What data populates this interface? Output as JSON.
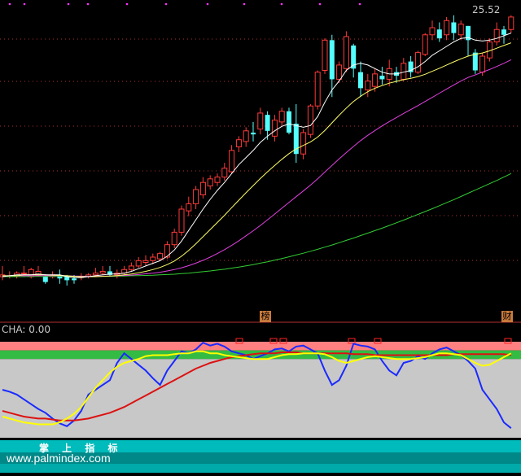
{
  "price_panel": {
    "last_price_label": "25.52",
    "badges": [
      "榜",
      "财"
    ]
  },
  "indicator_panel": {
    "cha_label": "CHA: 0.00"
  },
  "footer": {
    "title": "掌 上 指 标",
    "url": "www.palmindex.com"
  },
  "colors": {
    "background": "#000000",
    "candle_up": "#ff3a3a",
    "candle_down": "#54ffff",
    "ma_white": "#ffffff",
    "ma_yellow": "#ffff66",
    "ma_magenta": "#e040e0",
    "ma_green": "#33cc33",
    "band_red": "#ff8080",
    "band_green": "#33bb44",
    "band_gray": "#c8c8c8",
    "line_blue": "#1a2aff",
    "line_red": "#dd1111",
    "line_yellow": "#ffff00",
    "footer_teal": "#00bbbb"
  },
  "chart_data": [
    {
      "type": "candlestick",
      "title": "",
      "ylabel": "",
      "last_price": 25.52,
      "ylim": [
        9.3,
        26.0
      ],
      "candles": [
        [
          10.9,
          11.0,
          11.5,
          10.7
        ],
        [
          10.9,
          10.95,
          11.2,
          10.8
        ],
        [
          10.9,
          11.1,
          11.2,
          10.8
        ],
        [
          11.1,
          11.1,
          11.5,
          10.9
        ],
        [
          10.9,
          11.3,
          11.4,
          10.8
        ],
        [
          11.0,
          11.2,
          11.5,
          10.9
        ],
        [
          10.9,
          10.6,
          11.0,
          10.5
        ],
        [
          10.9,
          11.0,
          11.2,
          10.8
        ],
        [
          11.0,
          10.8,
          11.3,
          10.5
        ],
        [
          10.9,
          10.7,
          11.0,
          10.4
        ],
        [
          10.8,
          10.7,
          11.0,
          10.5
        ],
        [
          10.9,
          10.9,
          11.1,
          10.7
        ],
        [
          10.9,
          11.0,
          11.1,
          10.8
        ],
        [
          11.0,
          11.1,
          11.4,
          10.9
        ],
        [
          11.1,
          11.2,
          11.5,
          11.0
        ],
        [
          11.2,
          11.0,
          11.5,
          10.9
        ],
        [
          11.0,
          11.1,
          11.3,
          10.8
        ],
        [
          11.1,
          11.3,
          11.5,
          11.0
        ],
        [
          11.3,
          11.5,
          11.7,
          11.2
        ],
        [
          11.5,
          11.8,
          12.0,
          11.4
        ],
        [
          11.7,
          11.8,
          12.1,
          11.5
        ],
        [
          11.8,
          12.0,
          12.2,
          11.6
        ],
        [
          11.9,
          12.2,
          12.3,
          11.8
        ],
        [
          12.0,
          12.7,
          12.9,
          11.9
        ],
        [
          12.7,
          13.4,
          13.6,
          12.5
        ],
        [
          13.4,
          14.7,
          14.9,
          13.2
        ],
        [
          14.6,
          15.0,
          15.4,
          14.3
        ],
        [
          15.0,
          15.8,
          16.0,
          14.7
        ],
        [
          15.5,
          16.2,
          16.5,
          15.3
        ],
        [
          16.0,
          16.4,
          16.6,
          15.8
        ],
        [
          16.2,
          16.5,
          16.7,
          16.0
        ],
        [
          16.5,
          17.0,
          17.3,
          16.3
        ],
        [
          16.8,
          18.0,
          18.3,
          16.7
        ],
        [
          18.2,
          18.6,
          18.8,
          17.9
        ],
        [
          18.5,
          19.1,
          19.3,
          18.2
        ],
        [
          19.0,
          18.9,
          19.6,
          18.5
        ],
        [
          19.2,
          20.1,
          20.4,
          18.9
        ],
        [
          20.0,
          19.1,
          20.2,
          18.6
        ],
        [
          18.8,
          19.7,
          20.0,
          18.5
        ],
        [
          19.6,
          20.2,
          20.4,
          19.4
        ],
        [
          20.2,
          19.0,
          20.4,
          18.9
        ],
        [
          19.5,
          17.8,
          20.6,
          17.3
        ],
        [
          17.8,
          19.0,
          19.2,
          17.5
        ],
        [
          18.9,
          20.5,
          20.6,
          18.7
        ],
        [
          20.5,
          22.4,
          22.5,
          20.3
        ],
        [
          22.5,
          24.2,
          24.3,
          22.3
        ],
        [
          24.2,
          22.0,
          24.5,
          21.0
        ],
        [
          22.0,
          22.8,
          23.0,
          21.8
        ],
        [
          22.6,
          24.4,
          24.7,
          22.4
        ],
        [
          23.9,
          22.6,
          24.0,
          22.1
        ],
        [
          22.4,
          21.5,
          23.0,
          21.0
        ],
        [
          21.4,
          21.9,
          22.3,
          21.0
        ],
        [
          21.6,
          22.3,
          22.6,
          21.3
        ],
        [
          22.2,
          22.0,
          22.7,
          21.7
        ],
        [
          22.0,
          22.6,
          23.1,
          21.6
        ],
        [
          22.4,
          22.2,
          22.7,
          21.8
        ],
        [
          22.0,
          22.9,
          23.2,
          21.9
        ],
        [
          23.0,
          22.4,
          23.3,
          22.1
        ],
        [
          22.4,
          23.5,
          23.6,
          22.3
        ],
        [
          23.4,
          24.5,
          24.6,
          23.3
        ],
        [
          24.5,
          24.9,
          25.3,
          24.2
        ],
        [
          24.8,
          24.3,
          25.2,
          24.1
        ],
        [
          24.5,
          25.3,
          25.5,
          24.2
        ],
        [
          25.2,
          24.6,
          25.6,
          24.2
        ],
        [
          24.5,
          25.1,
          25.3,
          24.2
        ],
        [
          25.0,
          24.2,
          25.0,
          23.3
        ],
        [
          23.5,
          22.5,
          23.7,
          22.3
        ],
        [
          22.4,
          23.3,
          23.5,
          22.2
        ],
        [
          23.2,
          24.1,
          24.3,
          23.0
        ],
        [
          24.1,
          24.8,
          25.2,
          23.9
        ],
        [
          24.8,
          24.5,
          25.0,
          24.0
        ],
        [
          24.8,
          25.5,
          25.6,
          24.6
        ]
      ],
      "ma_white": [
        10.9,
        10.95,
        11.0,
        11.0,
        11.0,
        11.05,
        11.0,
        11.0,
        11.0,
        10.9,
        10.85,
        10.85,
        10.9,
        10.95,
        11.0,
        11.05,
        11.05,
        11.1,
        11.2,
        11.35,
        11.5,
        11.65,
        11.8,
        12.05,
        12.4,
        12.9,
        13.5,
        14.1,
        14.7,
        15.25,
        15.75,
        16.2,
        16.7,
        17.2,
        17.6,
        18.0,
        18.45,
        18.8,
        19.1,
        19.35,
        19.5,
        19.4,
        19.3,
        19.4,
        19.9,
        20.7,
        21.4,
        21.9,
        22.5,
        22.8,
        22.9,
        22.8,
        22.6,
        22.4,
        22.3,
        22.3,
        22.4,
        22.5,
        22.7,
        23.0,
        23.35,
        23.6,
        23.85,
        24.1,
        24.3,
        24.35,
        24.2,
        24.15,
        24.2,
        24.3,
        24.45,
        24.6
      ],
      "ma_yellow": [
        10.95,
        10.95,
        10.95,
        11.0,
        11.0,
        11.0,
        11.0,
        10.98,
        10.97,
        10.95,
        10.92,
        10.9,
        10.9,
        10.9,
        10.92,
        10.94,
        10.96,
        11.0,
        11.05,
        11.12,
        11.2,
        11.3,
        11.42,
        11.58,
        11.78,
        12.05,
        12.38,
        12.75,
        13.15,
        13.55,
        13.95,
        14.35,
        14.78,
        15.2,
        15.62,
        16.02,
        16.42,
        16.8,
        17.15,
        17.5,
        17.82,
        18.08,
        18.28,
        18.48,
        18.75,
        19.12,
        19.55,
        19.98,
        20.38,
        20.75,
        21.05,
        21.3,
        21.5,
        21.65,
        21.78,
        21.88,
        21.98,
        22.05,
        22.15,
        22.28,
        22.45,
        22.62,
        22.8,
        22.98,
        23.15,
        23.3,
        23.4,
        23.48,
        23.6,
        23.75,
        23.9,
        24.05
      ],
      "ma_magenta": [
        10.95,
        10.95,
        10.95,
        10.95,
        10.95,
        10.96,
        10.96,
        10.96,
        10.96,
        10.95,
        10.94,
        10.93,
        10.92,
        10.92,
        10.93,
        10.94,
        10.95,
        10.97,
        10.99,
        11.02,
        11.06,
        11.1,
        11.15,
        11.22,
        11.3,
        11.4,
        11.52,
        11.66,
        11.82,
        12.0,
        12.2,
        12.42,
        12.66,
        12.92,
        13.2,
        13.48,
        13.78,
        14.1,
        14.42,
        14.75,
        15.08,
        15.4,
        15.72,
        16.05,
        16.4,
        16.78,
        17.15,
        17.52,
        17.88,
        18.22,
        18.55,
        18.85,
        19.12,
        19.38,
        19.62,
        19.85,
        20.08,
        20.3,
        20.52,
        20.75,
        20.98,
        21.22,
        21.45,
        21.68,
        21.9,
        22.1,
        22.25,
        22.4,
        22.55,
        22.72,
        22.9,
        23.1
      ],
      "ma_green": [
        10.9,
        10.9,
        10.9,
        10.9,
        10.91,
        10.91,
        10.91,
        10.91,
        10.91,
        10.91,
        10.91,
        10.91,
        10.91,
        10.91,
        10.92,
        10.92,
        10.93,
        10.94,
        10.95,
        10.96,
        10.97,
        10.98,
        11.0,
        11.02,
        11.04,
        11.07,
        11.1,
        11.14,
        11.18,
        11.22,
        11.27,
        11.32,
        11.38,
        11.44,
        11.51,
        11.58,
        11.66,
        11.74,
        11.83,
        11.92,
        12.02,
        12.12,
        12.22,
        12.33,
        12.44,
        12.56,
        12.68,
        12.81,
        12.94,
        13.07,
        13.21,
        13.35,
        13.49,
        13.63,
        13.78,
        13.93,
        14.08,
        14.24,
        14.4,
        14.56,
        14.72,
        14.89,
        15.06,
        15.23,
        15.41,
        15.59,
        15.77,
        15.95,
        16.13,
        16.31,
        16.5,
        16.7
      ]
    },
    {
      "type": "line",
      "title": "CHA: 0.00",
      "ylim": [
        0,
        100
      ],
      "bands": [
        {
          "color": "band_red",
          "from": 91,
          "to": 100
        },
        {
          "color": "band_green",
          "from": 82,
          "to": 91
        },
        {
          "color": "band_gray",
          "from": 0,
          "to": 82
        }
      ],
      "series": [
        {
          "color": "line_blue",
          "values": [
            50,
            48,
            45,
            40,
            35,
            30,
            26,
            20,
            15,
            12,
            18,
            28,
            45,
            50,
            55,
            60,
            78,
            88,
            82,
            76,
            70,
            62,
            55,
            70,
            80,
            90,
            88,
            92,
            99,
            96,
            98,
            95,
            90,
            88,
            86,
            82,
            85,
            88,
            92,
            93,
            90,
            95,
            96,
            92,
            88,
            70,
            55,
            60,
            75,
            98,
            96,
            95,
            92,
            80,
            70,
            65,
            78,
            80,
            85,
            82,
            88,
            92,
            94,
            90,
            86,
            80,
            72,
            50,
            40,
            30,
            16,
            10
          ]
        },
        {
          "color": "line_red",
          "values": [
            28,
            26,
            24,
            22,
            21,
            20,
            20,
            19,
            18,
            18,
            18,
            19,
            20,
            22,
            24,
            26,
            29,
            32,
            36,
            40,
            44,
            48,
            52,
            56,
            60,
            64,
            68,
            72,
            75,
            78,
            80,
            82,
            84,
            85,
            86,
            87,
            88,
            88,
            88,
            89,
            89,
            89,
            88,
            88,
            88,
            88,
            88,
            88,
            88,
            87,
            87,
            87,
            86,
            86,
            86,
            86,
            86,
            86,
            86,
            86,
            86,
            86,
            86,
            87,
            87,
            87,
            87,
            87,
            87,
            87,
            87,
            86
          ]
        },
        {
          "color": "line_yellow",
          "values": [
            22,
            20,
            18,
            16,
            15,
            14,
            14,
            14,
            16,
            20,
            25,
            32,
            42,
            52,
            60,
            68,
            74,
            78,
            80,
            82,
            85,
            86,
            86,
            86,
            87,
            88,
            88,
            90,
            90,
            88,
            88,
            86,
            85,
            84,
            83,
            82,
            82,
            82,
            84,
            86,
            87,
            87,
            88,
            88,
            88,
            87,
            84,
            80,
            78,
            80,
            82,
            84,
            85,
            84,
            83,
            82,
            82,
            82,
            83,
            84,
            86,
            88,
            88,
            87,
            86,
            82,
            78,
            75,
            76,
            80,
            84,
            88
          ]
        }
      ]
    }
  ]
}
